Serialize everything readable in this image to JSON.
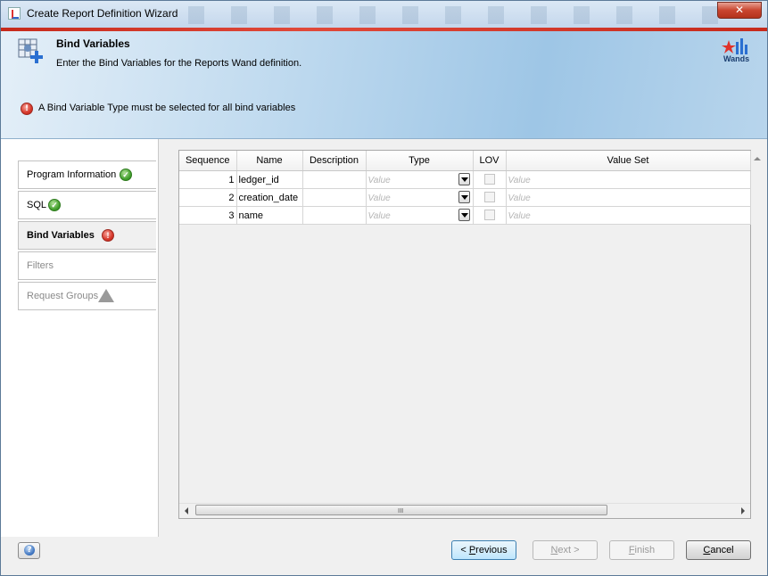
{
  "window": {
    "title": "Create Report Definition Wizard",
    "close_glyph": "✕"
  },
  "header": {
    "title": "Bind Variables",
    "subtitle": "Enter the Bind Variables for the Reports Wand definition.",
    "logo_text": "Wands",
    "error_message": "A Bind Variable Type must be selected for all bind variables"
  },
  "nav": {
    "items": [
      {
        "label": "Program Information",
        "status": "complete",
        "status_icon": "check-icon"
      },
      {
        "label": "SQL",
        "status": "complete",
        "status_icon": "check-icon"
      },
      {
        "label": "Bind Variables",
        "status": "error",
        "status_icon": "error-icon",
        "active": true
      },
      {
        "label": "Filters",
        "status": "disabled"
      },
      {
        "label": "Request Groups",
        "status": "warning",
        "status_icon": "warning-icon"
      }
    ]
  },
  "table": {
    "columns": [
      "Sequence",
      "Name",
      "Description",
      "Type",
      "LOV",
      "Value Set"
    ],
    "rows": [
      {
        "sequence": "1",
        "name": "ledger_id",
        "description": "",
        "type_placeholder": "Value",
        "lov": false,
        "value_set_placeholder": "Value"
      },
      {
        "sequence": "2",
        "name": "creation_date",
        "description": "",
        "type_placeholder": "Value",
        "lov": false,
        "value_set_placeholder": "Value"
      },
      {
        "sequence": "3",
        "name": "name",
        "description": "",
        "type_placeholder": "Value",
        "lov": false,
        "value_set_placeholder": "Value"
      }
    ],
    "scroll_grip": "III"
  },
  "footer": {
    "help_glyph": "?",
    "previous_label_pre": "< ",
    "previous_label_mnemonic": "P",
    "previous_label_post": "revious",
    "next_label_mnemonic": "N",
    "next_label_post": "ext >",
    "finish_label_mnemonic": "F",
    "finish_label_post": "inish",
    "cancel_label_mnemonic": "C",
    "cancel_label_post": "ancel"
  },
  "colors": {
    "accent_red": "#c62a1c",
    "banner_blue": "#9ec6e6",
    "ok_green": "#3f9e2a",
    "error_red": "#d6372a"
  }
}
